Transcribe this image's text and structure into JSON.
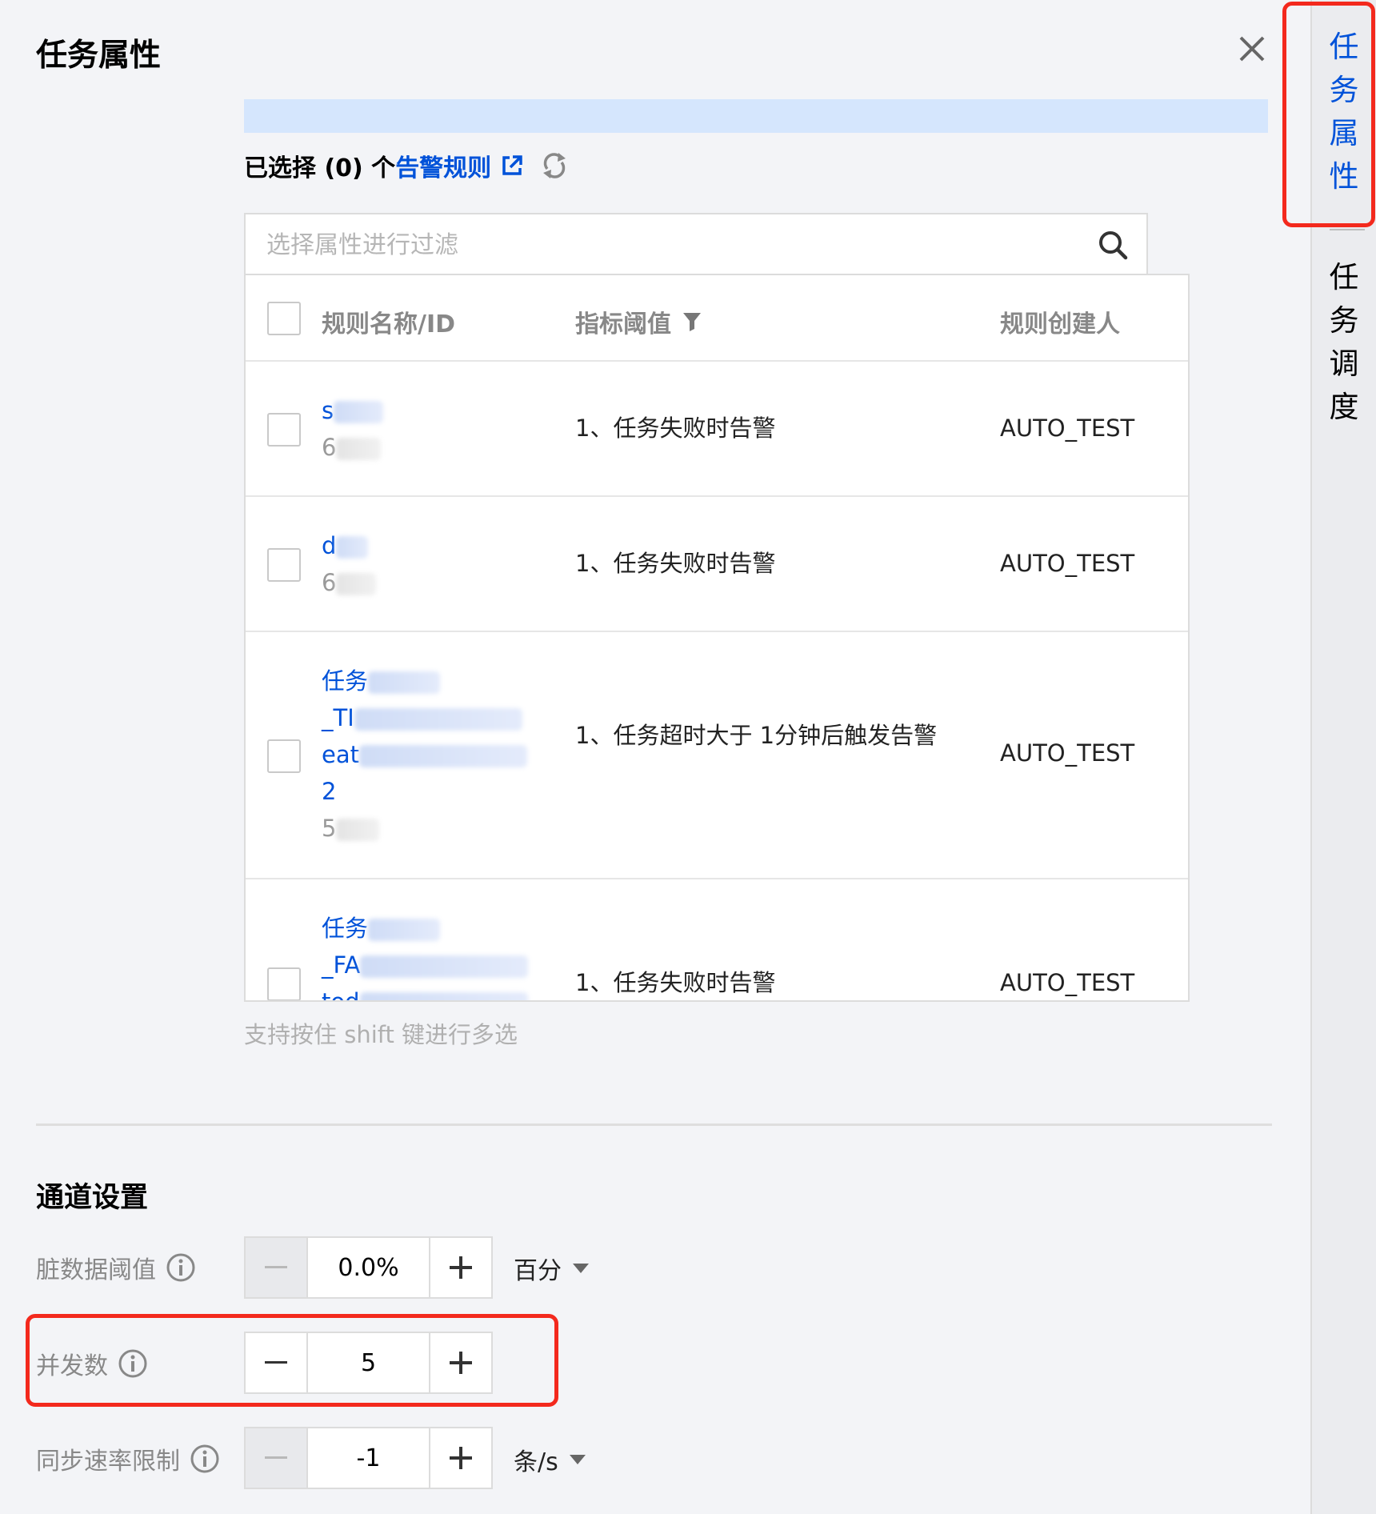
{
  "panel": {
    "title": "任务属性",
    "close_icon": "close-icon"
  },
  "alert_rules": {
    "selected_prefix": "已选择 (0) 个",
    "link_text": "告警规则",
    "filter_placeholder": "选择属性进行过滤",
    "columns": [
      "规则名称/ID",
      "指标阈值",
      "规则创建人"
    ],
    "rows": [
      {
        "name_visible": "s",
        "id_visible": "6",
        "threshold": "1、任务失败时告警",
        "creator": "AUTO_TEST"
      },
      {
        "name_visible": "d",
        "id_visible": "6",
        "threshold": "1、任务失败时告警",
        "creator": "AUTO_TEST"
      },
      {
        "name_lines": [
          "任务",
          "_TI",
          "eat",
          "2"
        ],
        "id_visible": "5",
        "threshold": "1、任务超时大于 1分钟后触发告警",
        "creator": "AUTO_TEST"
      },
      {
        "name_lines": [
          "任务",
          "_FA",
          "tod"
        ],
        "threshold": "1、任务失败时告警",
        "creator": "AUTO_TEST"
      }
    ],
    "hint": "支持按住 shift 键进行多选"
  },
  "channel_settings": {
    "title": "通道设置",
    "dirty_threshold": {
      "label": "脏数据阈值",
      "value": "0.0%",
      "unit": "百分"
    },
    "concurrency": {
      "label": "并发数",
      "value": "5"
    },
    "sync_rate_limit": {
      "label": "同步速率限制",
      "value": "-1",
      "unit": "条/s"
    }
  },
  "side_nav": {
    "tabs": [
      {
        "label": "任务属性",
        "chars": [
          "任",
          "务",
          "属",
          "性"
        ],
        "active": true
      },
      {
        "label": "任务调度",
        "chars": [
          "任",
          "务",
          "调",
          "度"
        ],
        "active": false
      }
    ]
  },
  "colors": {
    "accent": "#0052d9",
    "highlight_red": "#f3291d",
    "info_bar": "#d5e6fd"
  }
}
